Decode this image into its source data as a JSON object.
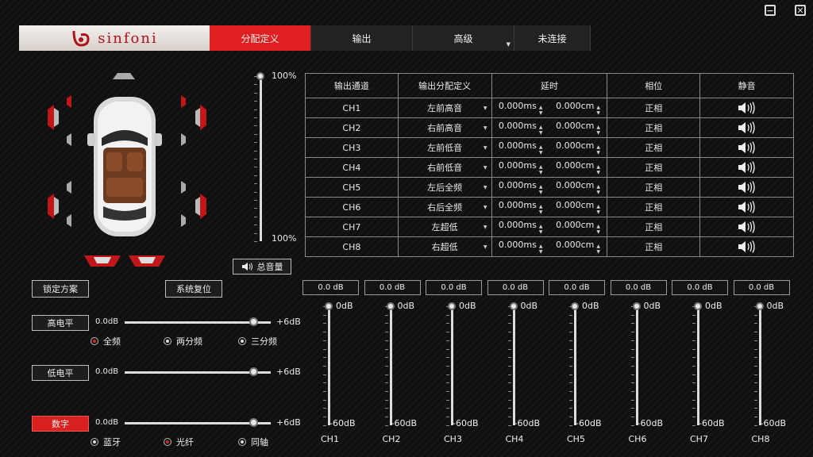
{
  "window": {
    "minimize_icon": "minimize-icon",
    "close_icon": "close-icon"
  },
  "brand": {
    "name": "sinfoni",
    "accent": "#e02020"
  },
  "nav": {
    "tabs": [
      {
        "label": "分配定义",
        "active": true
      },
      {
        "label": "输出",
        "active": false
      },
      {
        "label": "高级",
        "active": false
      },
      {
        "label": "未连接",
        "active": false
      }
    ]
  },
  "master": {
    "top_label": "100%",
    "bottom_label": "100%",
    "level_percent": 100,
    "button_label": "总音量"
  },
  "actions": {
    "lock_label": "锁定方案",
    "reset_label": "系统复位"
  },
  "table": {
    "headers": [
      "输出通道",
      "输出分配定义",
      "延时",
      "相位",
      "静音"
    ],
    "rows": [
      {
        "ch": "CH1",
        "assign": "左前高音",
        "ms": "0.000ms",
        "cm": "0.000cm",
        "phase": "正相"
      },
      {
        "ch": "CH2",
        "assign": "右前高音",
        "ms": "0.000ms",
        "cm": "0.000cm",
        "phase": "正相"
      },
      {
        "ch": "CH3",
        "assign": "左前低音",
        "ms": "0.000ms",
        "cm": "0.000cm",
        "phase": "正相"
      },
      {
        "ch": "CH4",
        "assign": "右前低音",
        "ms": "0.000ms",
        "cm": "0.000cm",
        "phase": "正相"
      },
      {
        "ch": "CH5",
        "assign": "左后全频",
        "ms": "0.000ms",
        "cm": "0.000cm",
        "phase": "正相"
      },
      {
        "ch": "CH6",
        "assign": "右后全频",
        "ms": "0.000ms",
        "cm": "0.000cm",
        "phase": "正相"
      },
      {
        "ch": "CH7",
        "assign": "左超低",
        "ms": "0.000ms",
        "cm": "0.000cm",
        "phase": "正相"
      },
      {
        "ch": "CH8",
        "assign": "右超低",
        "ms": "0.000ms",
        "cm": "0.000cm",
        "phase": "正相"
      }
    ]
  },
  "inputs": {
    "high": {
      "label": "高电平",
      "min": "0.0dB",
      "max": "+6dB",
      "level_fraction": 0.88
    },
    "low": {
      "label": "低电平",
      "min": "0.0dB",
      "max": "+6dB",
      "level_fraction": 0.88
    },
    "digital": {
      "label": "数字",
      "min": "0.0dB",
      "max": "+6dB",
      "level_fraction": 0.88,
      "active": true
    },
    "high_modes": [
      {
        "label": "全频",
        "selected": true
      },
      {
        "label": "两分频",
        "selected": false
      },
      {
        "label": "三分频",
        "selected": false
      }
    ],
    "digital_modes": [
      {
        "label": "蓝牙",
        "selected": false
      },
      {
        "label": "光纤",
        "selected": true
      },
      {
        "label": "同轴",
        "selected": false
      }
    ]
  },
  "eq": {
    "top": "0dB",
    "bottom": "-60dB",
    "channels": [
      {
        "name": "CH1",
        "value": "0.0 dB"
      },
      {
        "name": "CH2",
        "value": "0.0 dB"
      },
      {
        "name": "CH3",
        "value": "0.0 dB"
      },
      {
        "name": "CH4",
        "value": "0.0 dB"
      },
      {
        "name": "CH5",
        "value": "0.0 dB"
      },
      {
        "name": "CH6",
        "value": "0.0 dB"
      },
      {
        "name": "CH7",
        "value": "0.0 dB"
      },
      {
        "name": "CH8",
        "value": "0.0 dB"
      }
    ]
  }
}
